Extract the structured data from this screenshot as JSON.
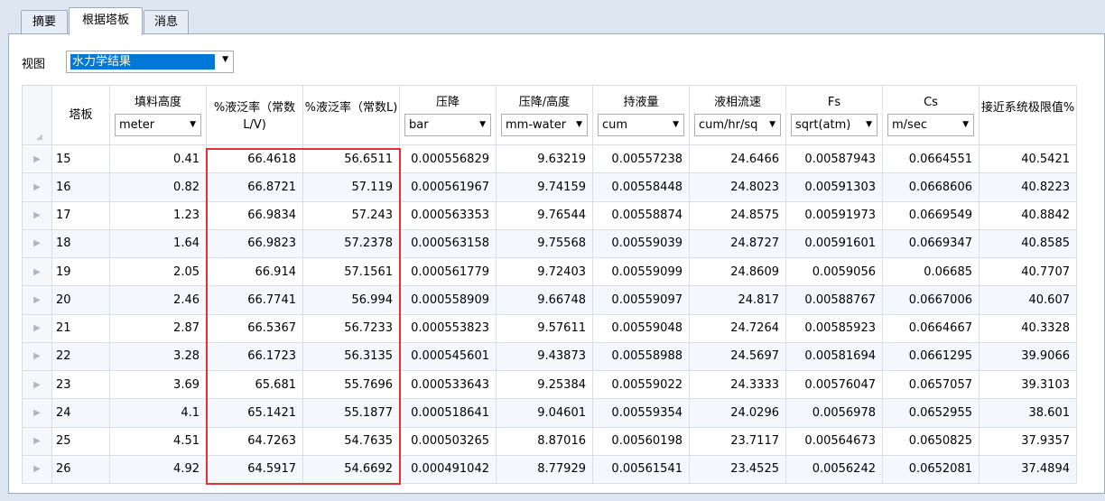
{
  "tabs": [
    {
      "label": "摘要",
      "active": false
    },
    {
      "label": "根据塔板",
      "active": true
    },
    {
      "label": "消息",
      "active": false
    }
  ],
  "view": {
    "label": "视图",
    "selected": "水力学结果"
  },
  "columns": [
    {
      "title": "塔板",
      "unit": null
    },
    {
      "title": "填料高度",
      "unit": "meter"
    },
    {
      "title": "%液泛率（常数L/V)",
      "unit": null
    },
    {
      "title": "%液泛率（常数L)",
      "unit": null
    },
    {
      "title": "压降",
      "unit": "bar"
    },
    {
      "title": "压降/高度",
      "unit": "mm-water"
    },
    {
      "title": "持液量",
      "unit": "cum"
    },
    {
      "title": "液相流速",
      "unit": "cum/hr/sq"
    },
    {
      "title": "Fs",
      "unit": "sqrt(atm)"
    },
    {
      "title": "Cs",
      "unit": "m/sec"
    },
    {
      "title": "接近系统极限值%",
      "unit": null
    }
  ],
  "rows": [
    [
      "15",
      "0.41",
      "66.4618",
      "56.6511",
      "0.000556829",
      "9.63219",
      "0.00557238",
      "24.6466",
      "0.00587943",
      "0.0664551",
      "40.5421"
    ],
    [
      "16",
      "0.82",
      "66.8721",
      "57.119",
      "0.000561967",
      "9.74159",
      "0.00558448",
      "24.8023",
      "0.00591303",
      "0.0668606",
      "40.8223"
    ],
    [
      "17",
      "1.23",
      "66.9834",
      "57.243",
      "0.000563353",
      "9.76544",
      "0.00558874",
      "24.8575",
      "0.00591973",
      "0.0669549",
      "40.8842"
    ],
    [
      "18",
      "1.64",
      "66.9823",
      "57.2378",
      "0.000563158",
      "9.75568",
      "0.00559039",
      "24.8727",
      "0.00591601",
      "0.0669347",
      "40.8585"
    ],
    [
      "19",
      "2.05",
      "66.914",
      "57.1561",
      "0.000561779",
      "9.72403",
      "0.00559099",
      "24.8609",
      "0.0059056",
      "0.06685",
      "40.7707"
    ],
    [
      "20",
      "2.46",
      "66.7741",
      "56.994",
      "0.000558909",
      "9.66748",
      "0.00559097",
      "24.817",
      "0.00588767",
      "0.0667006",
      "40.607"
    ],
    [
      "21",
      "2.87",
      "66.5367",
      "56.7233",
      "0.000553823",
      "9.57611",
      "0.00559048",
      "24.7264",
      "0.00585923",
      "0.0664667",
      "40.3328"
    ],
    [
      "22",
      "3.28",
      "66.1723",
      "56.3135",
      "0.000545601",
      "9.43873",
      "0.00558988",
      "24.5697",
      "0.00581694",
      "0.0661295",
      "39.9066"
    ],
    [
      "23",
      "3.69",
      "65.681",
      "55.7696",
      "0.000533643",
      "9.25384",
      "0.00559022",
      "24.3333",
      "0.00576047",
      "0.0657057",
      "39.3103"
    ],
    [
      "24",
      "4.1",
      "65.1421",
      "55.1877",
      "0.000518641",
      "9.04601",
      "0.00559354",
      "24.0296",
      "0.0056978",
      "0.0652955",
      "38.601"
    ],
    [
      "25",
      "4.51",
      "64.7263",
      "54.7635",
      "0.000503265",
      "8.87016",
      "0.00560198",
      "23.7117",
      "0.00564673",
      "0.0650825",
      "37.9357"
    ],
    [
      "26",
      "4.92",
      "64.5917",
      "54.6692",
      "0.000491042",
      "8.77929",
      "0.00561541",
      "23.4525",
      "0.0056242",
      "0.0652081",
      "37.4894"
    ]
  ]
}
